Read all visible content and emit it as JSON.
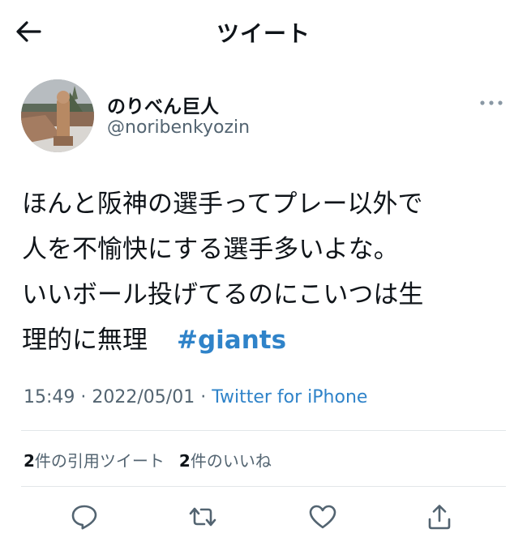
{
  "header": {
    "title": "ツイート",
    "back_icon": "arrow-left-icon"
  },
  "author": {
    "name": "のりべん巨人",
    "handle": "@noribenkyozin",
    "more_icon": "more-dots-icon"
  },
  "tweet": {
    "lines": [
      "ほんと阪神の選手ってプレー以外で",
      "人を不愉快にする選手多いよな。",
      "いいボール投げてるのにこいつは生",
      "理的に無理"
    ],
    "hashtag": "#giants",
    "time": "15:49",
    "date": "2022/05/01",
    "separator": " · ",
    "source": "Twitter for iPhone"
  },
  "stats": {
    "quote_count": "2",
    "quote_label": "件の引用ツイート",
    "like_count": "2",
    "like_label": "件のいいね"
  },
  "actions": [
    "reply-icon",
    "retweet-icon",
    "like-icon",
    "share-icon"
  ],
  "colors": {
    "link": "#2f83c9",
    "secondary_text": "#536471",
    "text": "#0f1419",
    "divider": "#e2e6e9"
  }
}
